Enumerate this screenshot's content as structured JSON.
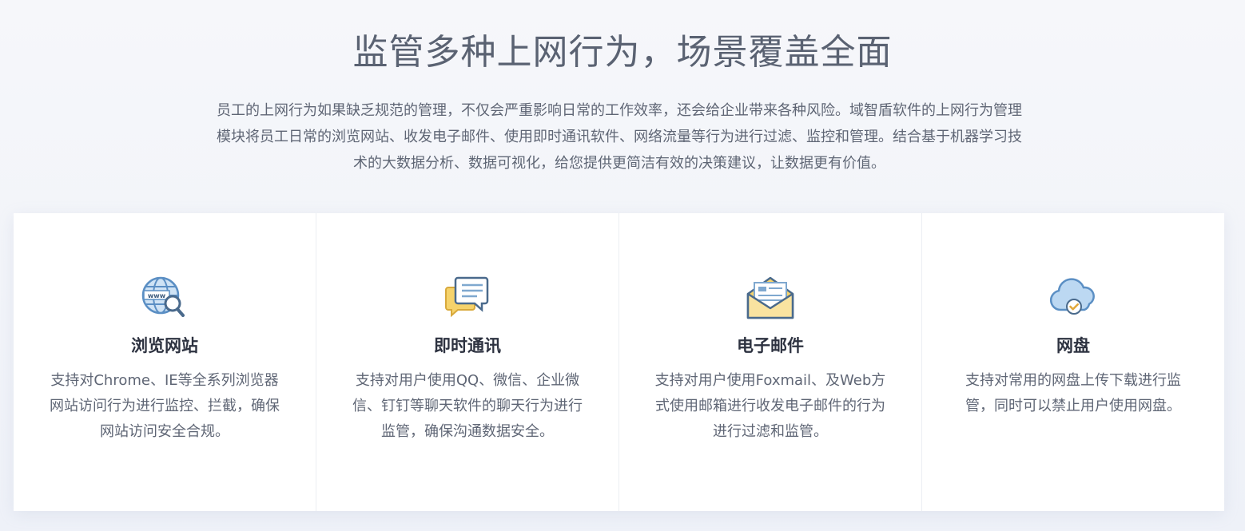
{
  "header": {
    "title": "监管多种上网行为，场景覆盖全面",
    "intro": "员工的上网行为如果缺乏规范的管理，不仅会严重影响日常的工作效率，还会给企业带来各种风险。域智盾软件的上网行为管理模块将员工日常的浏览网站、收发电子邮件、使用即时通讯软件、网络流量等行为进行过滤、监控和管理。结合基于机器学习技术的大数据分析、数据可视化，给您提供更简洁有效的决策建议，让数据更有价值。"
  },
  "cards": [
    {
      "icon": "globe-search-icon",
      "title": "浏览网站",
      "desc": "支持对Chrome、IE等全系列浏览器网站访问行为进行监控、拦截，确保网站访问安全合规。"
    },
    {
      "icon": "chat-bubbles-icon",
      "title": "即时通讯",
      "desc": "支持对用户使用QQ、微信、企业微信、钉钉等聊天软件的聊天行为进行监管，确保沟通数据安全。"
    },
    {
      "icon": "envelope-icon",
      "title": "电子邮件",
      "desc": "支持对用户使用Foxmail、及Web方式使用邮箱进行收发电子邮件的行为进行过滤和监管。"
    },
    {
      "icon": "cloud-check-icon",
      "title": "网盘",
      "desc": "支持对常用的网盘上传下载进行监管，同时可以禁止用户使用网盘。"
    }
  ],
  "colors": {
    "title": "#5a6272",
    "text": "#5f6675",
    "card_title": "#2d3240",
    "icon_blue": "#5b9bd5",
    "icon_yellow": "#f6d36b"
  }
}
